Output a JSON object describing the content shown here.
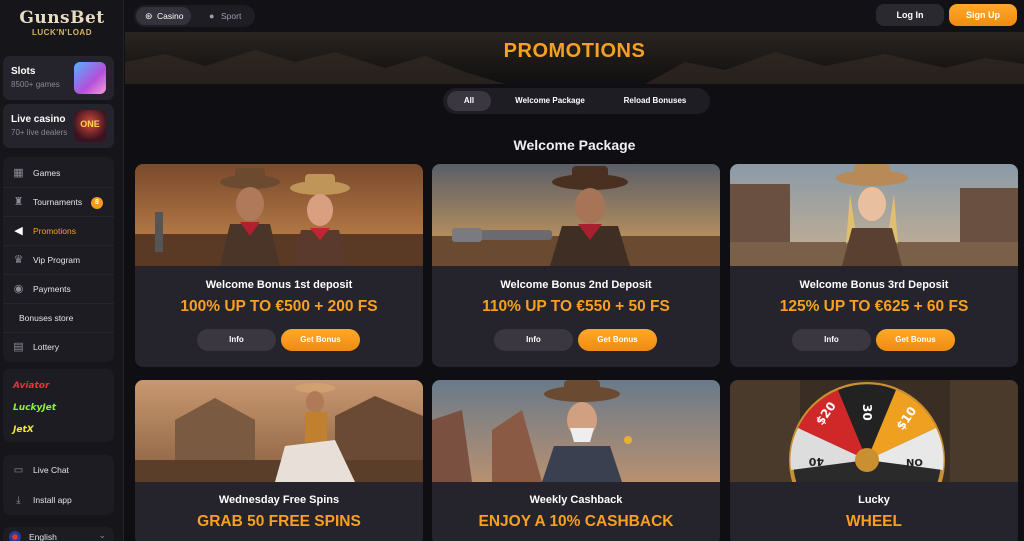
{
  "brand": {
    "name": "GunsBet",
    "tagline": "LUCK'N'LOAD"
  },
  "sidebar": {
    "tiles": [
      {
        "title": "Slots",
        "subtitle": "8500+ games"
      },
      {
        "title": "Live casino",
        "subtitle": "70+ live dealers",
        "image_text": "ONE"
      }
    ],
    "menu": [
      {
        "label": "Games",
        "icon": "slot-machine-icon"
      },
      {
        "label": "Tournaments",
        "icon": "trophy-icon",
        "badge": "8"
      },
      {
        "label": "Promotions",
        "icon": "megaphone-icon",
        "active": true
      },
      {
        "label": "Vip Program",
        "icon": "vip-icon"
      },
      {
        "label": "Payments",
        "icon": "coins-icon"
      },
      {
        "label": "Bonuses store",
        "icon": ""
      },
      {
        "label": "Lottery",
        "icon": "lottery-ticket-icon"
      }
    ],
    "games": [
      "Aviator",
      "LuckyJet",
      "JetX"
    ],
    "support": [
      {
        "label": "Live Chat",
        "icon": "chat-icon"
      },
      {
        "label": "Install app",
        "icon": "download-icon"
      }
    ],
    "language": "English"
  },
  "topbar": {
    "modes": [
      {
        "label": "Casino",
        "active": true
      },
      {
        "label": "Sport",
        "active": false
      }
    ],
    "login_label": "Log In",
    "signup_label": "Sign Up"
  },
  "main": {
    "title": "PROMOTIONS",
    "filters": [
      {
        "label": "All",
        "active": true
      },
      {
        "label": "Welcome Package",
        "active": false
      },
      {
        "label": "Reload Bonuses",
        "active": false
      }
    ],
    "section_title": "Welcome Package",
    "info_label": "Info",
    "get_label": "Get Bonus",
    "welcome_cards": [
      {
        "title": "Welcome Bonus 1st deposit",
        "offer": "100% UP TO €500 + 200 FS"
      },
      {
        "title": "Welcome Bonus 2nd Deposit",
        "offer": "110% UP TO €550 + 50 FS"
      },
      {
        "title": "Welcome Bonus 3rd Deposit",
        "offer": "125% UP TO €625 + 60 FS"
      }
    ],
    "other_cards": [
      {
        "title": "Wednesday Free Spins",
        "offer": "GRAB 50 FREE SPINS"
      },
      {
        "title": "Weekly Cashback",
        "offer": "ENJOY A 10% CASHBACK"
      },
      {
        "title": "Lucky",
        "offer": "WHEEL"
      }
    ],
    "wheel_segments": [
      "$20",
      "30",
      "$10",
      "40",
      "NO"
    ]
  },
  "colors": {
    "accent": "#f7a021",
    "background": "#0f0e12",
    "card": "#25232b"
  }
}
